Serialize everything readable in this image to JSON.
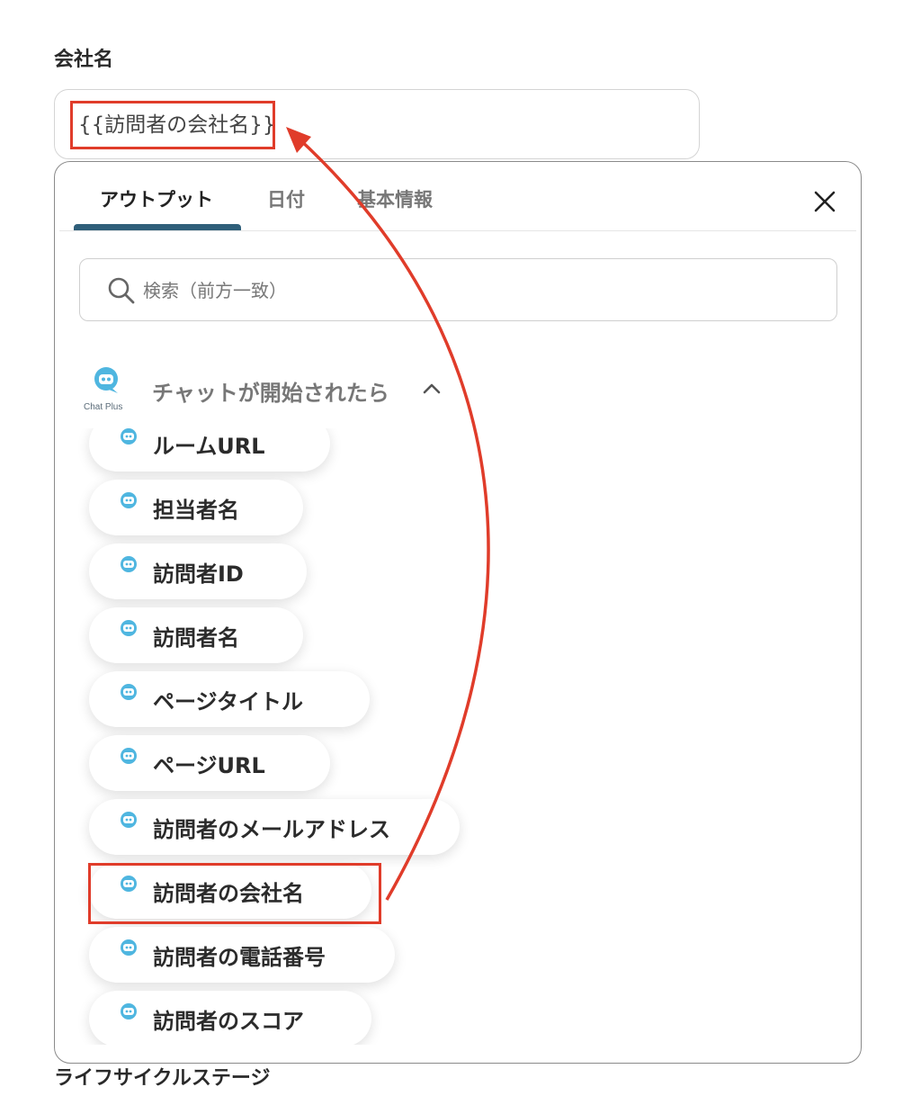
{
  "field": {
    "label": "会社名",
    "value": "{{訪問者の会社名}}"
  },
  "panel": {
    "tabs": [
      {
        "label": "アウトプット",
        "active": true
      },
      {
        "label": "日付",
        "active": false
      },
      {
        "label": "基本情報",
        "active": false
      }
    ],
    "search": {
      "placeholder": "検索（前方一致）"
    },
    "group": {
      "title": "チャットが開始されたら",
      "logo_text": "Chat Plus",
      "expanded": true
    },
    "items": [
      {
        "label": "ルームURL"
      },
      {
        "label": "担当者名"
      },
      {
        "label": "訪問者ID"
      },
      {
        "label": "訪問者名"
      },
      {
        "label": "ページタイトル"
      },
      {
        "label": "ページURL"
      },
      {
        "label": "訪問者のメールアドレス"
      },
      {
        "label": "訪問者の会社名",
        "highlighted": true
      },
      {
        "label": "訪問者の電話番号"
      },
      {
        "label": "訪問者のスコア"
      }
    ]
  },
  "next_field": {
    "label": "ライフサイクルステージ"
  },
  "colors": {
    "annotation": "#e03c2a",
    "tab_underline": "#2f5f7a",
    "logo": "#4fb6e0"
  },
  "icons": [
    "search-icon",
    "close-icon",
    "chevron-up-icon",
    "chat-plus-logo"
  ]
}
